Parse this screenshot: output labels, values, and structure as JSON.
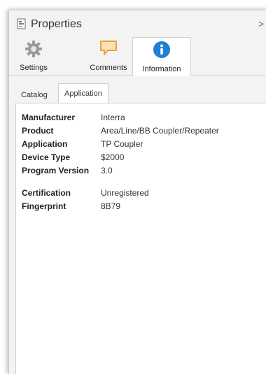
{
  "panel": {
    "title": "Properties",
    "chevron": ">"
  },
  "main_tabs": [
    {
      "label": "Settings"
    },
    {
      "label": "Comments"
    },
    {
      "label": "Information"
    }
  ],
  "sub_tabs": [
    {
      "label": "Catalog"
    },
    {
      "label": "Application"
    }
  ],
  "properties": {
    "group1": [
      {
        "key": "Manufacturer",
        "value": "Interra"
      },
      {
        "key": "Product",
        "value": "Area/Line/BB Coupler/Repeater"
      },
      {
        "key": "Application",
        "value": "TP Coupler"
      },
      {
        "key": "Device Type",
        "value": "$2000"
      },
      {
        "key": "Program Version",
        "value": "3.0"
      }
    ],
    "group2": [
      {
        "key": "Certification",
        "value": "Unregistered"
      },
      {
        "key": "Fingerprint",
        "value": "8B79"
      }
    ]
  },
  "colors": {
    "info_blue": "#1f7fd1",
    "comment_orange": "#e8a33a",
    "gear_gray": "#9a9a9a"
  }
}
